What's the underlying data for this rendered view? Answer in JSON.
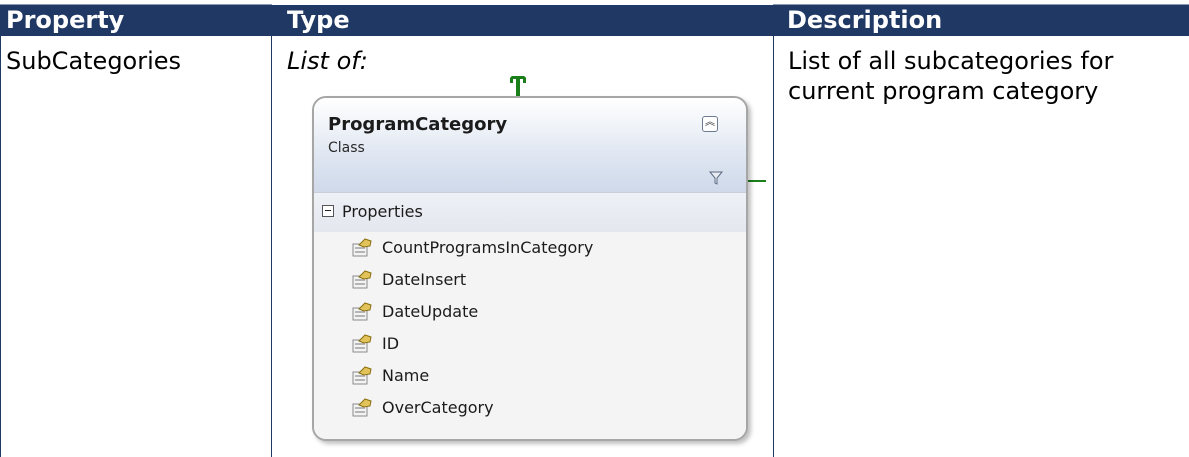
{
  "headers": {
    "property": "Property",
    "type": "Type",
    "description": "Description"
  },
  "row": {
    "property": "SubCategories",
    "type_label": "List of:",
    "description": "List of all subcategories for current program category"
  },
  "class_shape": {
    "name": "ProgramCategory",
    "kind": "Class",
    "section": "Properties",
    "members": [
      "CountProgramsInCategory",
      "DateInsert",
      "DateUpdate",
      "ID",
      "Name",
      "OverCategory"
    ],
    "collapse_glyph": "︽"
  },
  "colors": {
    "header_bg": "#1f3864",
    "connector": "#1a7f1a"
  }
}
